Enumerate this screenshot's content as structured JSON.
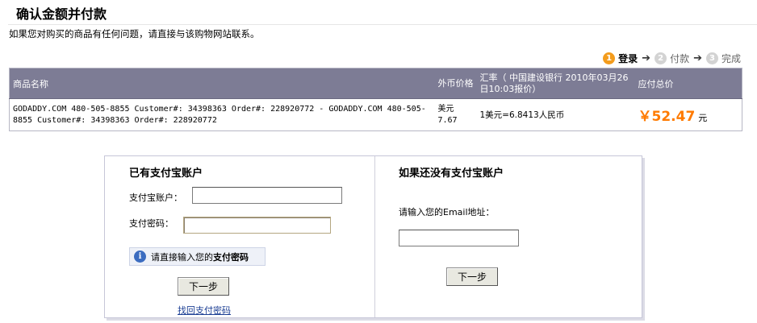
{
  "page": {
    "title": "确认金额并付款",
    "notice": "如果您对购买的商品有任何问题，请直接与该购物网站联系。"
  },
  "steps": [
    {
      "num": "1",
      "label": "登录",
      "active": true
    },
    {
      "num": "2",
      "label": "付款",
      "active": false
    },
    {
      "num": "3",
      "label": "完成",
      "active": false
    }
  ],
  "step_arrow": "➔",
  "table": {
    "headers": {
      "product": "商品名称",
      "currency_price": "外币价格",
      "rate": "汇率（ 中国建设银行 2010年03月26日10:03报价）",
      "total": "应付总价"
    },
    "row": {
      "product": "GODADDY.COM 480-505-8855 Customer#: 34398363 Order#: 228920772 - GODADDY.COM 480-505-8855 Customer#: 34398363 Order#: 228920772",
      "currency_price": "美元 7.67",
      "rate": "1美元=6.8413人民币",
      "total_amount": "￥52.47",
      "total_unit": "元"
    }
  },
  "existing_account": {
    "heading": "已有支付宝账户",
    "account_label": "支付宝账户：",
    "account_value": "",
    "password_label": "支付密码：",
    "password_value": "",
    "hint_prefix": "请直接输入您的",
    "hint_bold": "支付密码",
    "info_icon": "i",
    "next_button": "下一步",
    "recover_link": "找回支付密码"
  },
  "new_account": {
    "heading": "如果还没有支付宝账户",
    "email_label": "请输入您的Email地址：",
    "email_value": "",
    "next_button": "下一步"
  },
  "colors": {
    "table_header_bg": "#7d7c95",
    "price_color": "#ff7a00",
    "step_active": "#f39c1d",
    "link_color": "#1c3f94"
  }
}
